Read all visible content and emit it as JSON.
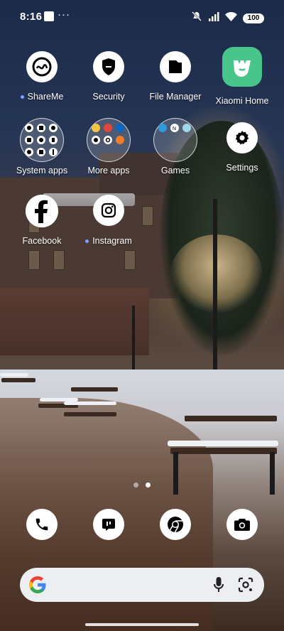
{
  "status_bar": {
    "time": "8:16",
    "more": "···",
    "battery": "100"
  },
  "apps": {
    "shareme": {
      "label": "ShareMe",
      "icon": "shareme-icon"
    },
    "security": {
      "label": "Security",
      "icon": "shield-icon"
    },
    "file_manager": {
      "label": "File Manager",
      "icon": "folder-icon"
    },
    "xiaomi_home": {
      "label": "Xiaomi Home",
      "icon": "mi-home-icon"
    },
    "system_apps": {
      "label": "System apps",
      "icon": "folder-grid-icon"
    },
    "more_apps": {
      "label": "More apps",
      "icon": "folder-grid-icon"
    },
    "games": {
      "label": "Games",
      "icon": "folder-grid-icon"
    },
    "settings": {
      "label": "Settings",
      "icon": "gear-icon"
    },
    "facebook": {
      "label": "Facebook",
      "icon": "facebook-icon"
    },
    "instagram": {
      "label": "Instagram",
      "icon": "instagram-icon"
    }
  },
  "page_indicator": {
    "pages": 2,
    "current": 2
  },
  "dock": [
    "phone-icon",
    "messages-icon",
    "chrome-icon",
    "camera-icon"
  ],
  "search": {
    "google": "G"
  },
  "colors": {
    "accent_dot": "#7aa2ff",
    "xiaomi_green": "#47c58a"
  }
}
